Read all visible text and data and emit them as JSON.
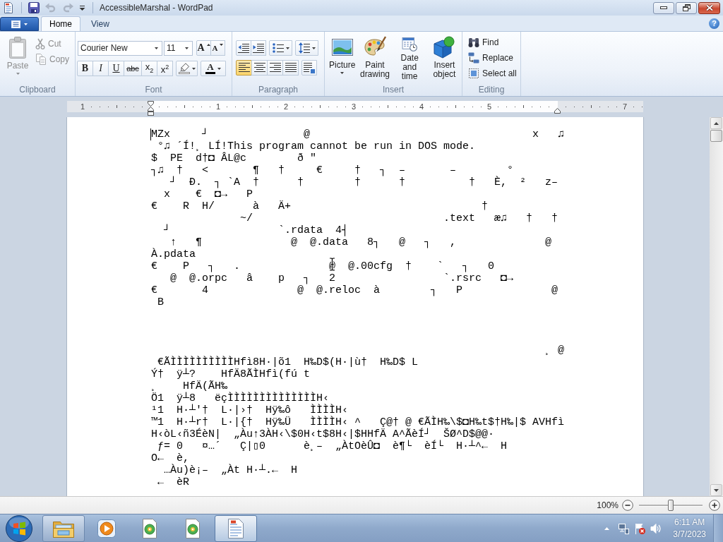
{
  "window": {
    "title": "AccessibleMarshal - WordPad"
  },
  "quick_access": [
    {
      "kind": "save",
      "disabled": false
    },
    {
      "kind": "undo",
      "disabled": true
    },
    {
      "kind": "redo",
      "disabled": true
    },
    {
      "kind": "customize",
      "disabled": false
    }
  ],
  "tabs": [
    {
      "label": "Home",
      "selected": true
    },
    {
      "label": "View",
      "selected": false
    }
  ],
  "help_button": {
    "label": "?"
  },
  "ribbon": {
    "groups": [
      {
        "kind": "clipboard",
        "label": "Clipboard",
        "items": [
          {
            "kind": "paste",
            "label": "Paste",
            "disabled": true
          },
          {
            "kind": "cut",
            "label": "Cut",
            "disabled": true
          },
          {
            "kind": "copy",
            "label": "Copy",
            "disabled": true
          }
        ]
      },
      {
        "kind": "font",
        "label": "Font",
        "font_name": {
          "value": "Courier New"
        },
        "font_size": {
          "value": "11"
        },
        "items": [
          {
            "kind": "grow_font",
            "label": "A"
          },
          {
            "kind": "shrink_font",
            "label": "A"
          },
          {
            "kind": "bold",
            "label": "B",
            "selected": false
          },
          {
            "kind": "italic",
            "label": "I",
            "selected": false
          },
          {
            "kind": "underline",
            "label": "U",
            "selected": false
          },
          {
            "kind": "strikethrough",
            "label": "abc",
            "selected": false
          },
          {
            "kind": "subscript",
            "label": "x$_{2}$",
            "selected": false
          },
          {
            "kind": "superscript",
            "label": "x$^{2}$",
            "selected": false
          },
          {
            "kind": "highlight"
          },
          {
            "kind": "font_color",
            "label": "A"
          }
        ]
      },
      {
        "kind": "paragraph",
        "label": "Paragraph",
        "items": [
          {
            "kind": "decrease_indent"
          },
          {
            "kind": "increase_indent"
          },
          {
            "kind": "bullets"
          },
          {
            "kind": "line_spacing"
          },
          {
            "kind": "align_left",
            "selected": true
          },
          {
            "kind": "align_center",
            "selected": false
          },
          {
            "kind": "align_right",
            "selected": false
          },
          {
            "kind": "justify",
            "selected": false
          },
          {
            "kind": "paragraph_settings"
          }
        ]
      },
      {
        "kind": "insert",
        "label": "Insert",
        "items": [
          {
            "kind": "picture",
            "label": "Picture"
          },
          {
            "kind": "paint_drawing",
            "label": "Paint drawing"
          },
          {
            "kind": "date_time",
            "label": "Date and time"
          },
          {
            "kind": "insert_object",
            "label": "Insert object"
          }
        ]
      },
      {
        "kind": "editing",
        "label": "Editing",
        "items": [
          {
            "kind": "find",
            "label": "Find"
          },
          {
            "kind": "replace",
            "label": "Replace"
          },
          {
            "kind": "select_all",
            "label": "Select all"
          }
        ]
      }
    ]
  },
  "ruler": {
    "marks": [
      {
        "kind": "number",
        "label": "1"
      },
      {
        "kind": "left_indent"
      },
      {
        "kind": "number",
        "label": "1"
      },
      {
        "kind": "number",
        "label": "2"
      },
      {
        "kind": "number",
        "label": "3"
      },
      {
        "kind": "number",
        "label": "4"
      },
      {
        "kind": "number",
        "label": "5"
      },
      {
        "kind": "right_indent"
      },
      {
        "kind": "number",
        "label": "7"
      }
    ]
  },
  "document": {
    "caret": true,
    "mouse_pointer": true,
    "blocks": [
      {
        "kind": "text",
        "lines": [
          "MZx     ┘               @                                   x   ♫",
          " °♫ ´Í!¸ LÍ!This program cannot be run in DOS mode.",
          "$  PE  d†◘ ÂL@c        ð \"",
          "┐♫  †   <       ¶   †     €     †   ┐  –       –        °",
          "   ┘  Ð.  ┐ `A  †      †        †      †          †   È,  ²   z–",
          "  x    €  ◘→   P",
          "€    R  H/      à   Ä+                              †",
          "              ~/                              .text   æ♫   †   †",
          "  ┘                 `.rdata  4┤",
          "   ↑   ¶              @  @.data   8┐   @   ┐   ,              @",
          "À.pdata",
          "€    P   ┐   .              @  @.00cfg  †    `   ┐   0",
          "   @  @.orpc   â    p   ┐   2                 `.rsrc   ◘→",
          "€       4              @  @.reloc  à        ┐   P              @",
          " B"
        ]
      },
      {
        "kind": "blank"
      },
      {
        "kind": "blank"
      },
      {
        "kind": "blank"
      },
      {
        "kind": "text",
        "lines": [
          "                                                              ¸ @",
          " €ÃÌÌÌÌÌÌÌÌÌÌHfì8H·|õ1  H‰D$(H·|ù†  H‰D$ L",
          "Ý†  ÿ┴?    HfÄ8ÃÌHfì(fú t",
          "¸    HfÄ(ÃH‰",
          "Ö1  ÿ┴8   ëçÌÌÌÌÌÌÌÌÌÌÌÌÌÌH‹",
          "¹1  H·┴'†  L·|›†  Hÿ‰ô   ÌÌÌÌH‹",
          "™1  H·┴r†  L·|{†  Hÿ‰Ü   ÌÌÌÌH‹ ^   Ç@† @ €ÃÌH‰\\$◘H‰t$†H‰|$ AVHfì",
          "H‹òL‹ñ3ÉèN|  „Àu↑3ÀH‹\\$0H‹t$8H‹|$HHfÄ A^ÃèÍ┘  ŠØ^D$@@·",
          " ƒ= 0   ¤…´   Ç|▯0      è¸–  „ÀtOèÛ◘  è¶└  èÍ└  H·┴^←  H",
          "O←  è,",
          "  …Àu)è¡–  „Àt H·┴.←  H",
          " ←  èR"
        ]
      }
    ]
  },
  "status_bar": {
    "zoom": {
      "label": "100%",
      "level": 0.5
    }
  },
  "taskbar": {
    "buttons": [
      {
        "kind": "explorer",
        "running": true,
        "selected": false
      },
      {
        "kind": "media_player",
        "running": false,
        "selected": false
      },
      {
        "kind": "setup",
        "running": false,
        "selected": false
      },
      {
        "kind": "setup",
        "running": false,
        "selected": false
      },
      {
        "kind": "wordpad",
        "running": true,
        "selected": true
      }
    ],
    "tray": [
      {
        "kind": "show_hidden"
      },
      {
        "kind": "network"
      },
      {
        "kind": "action_center"
      },
      {
        "kind": "volume"
      }
    ],
    "clock": {
      "time": "6:11 AM",
      "date": "3/7/2023"
    }
  }
}
